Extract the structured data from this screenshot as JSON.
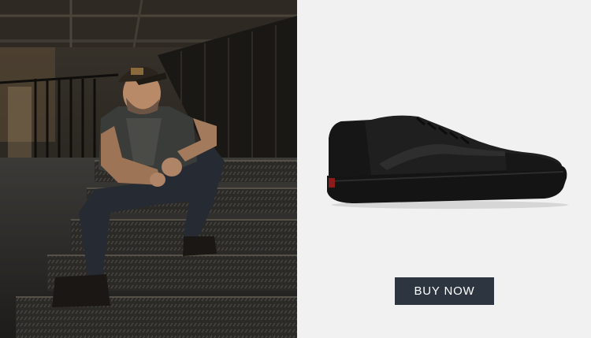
{
  "photo": {
    "alt_subject": "man-sitting-on-stairs",
    "colors": {
      "dark": "#14120f",
      "warm_light": "#c9a77a"
    }
  },
  "product": {
    "icon": "sneaker-icon",
    "colors": {
      "upper": "#1e1e1e",
      "sole": "#141414",
      "background": "#f1f1f1"
    }
  },
  "cta": {
    "label": "BUY NOW",
    "background": "#2d3540",
    "text_color": "#ffffff"
  }
}
